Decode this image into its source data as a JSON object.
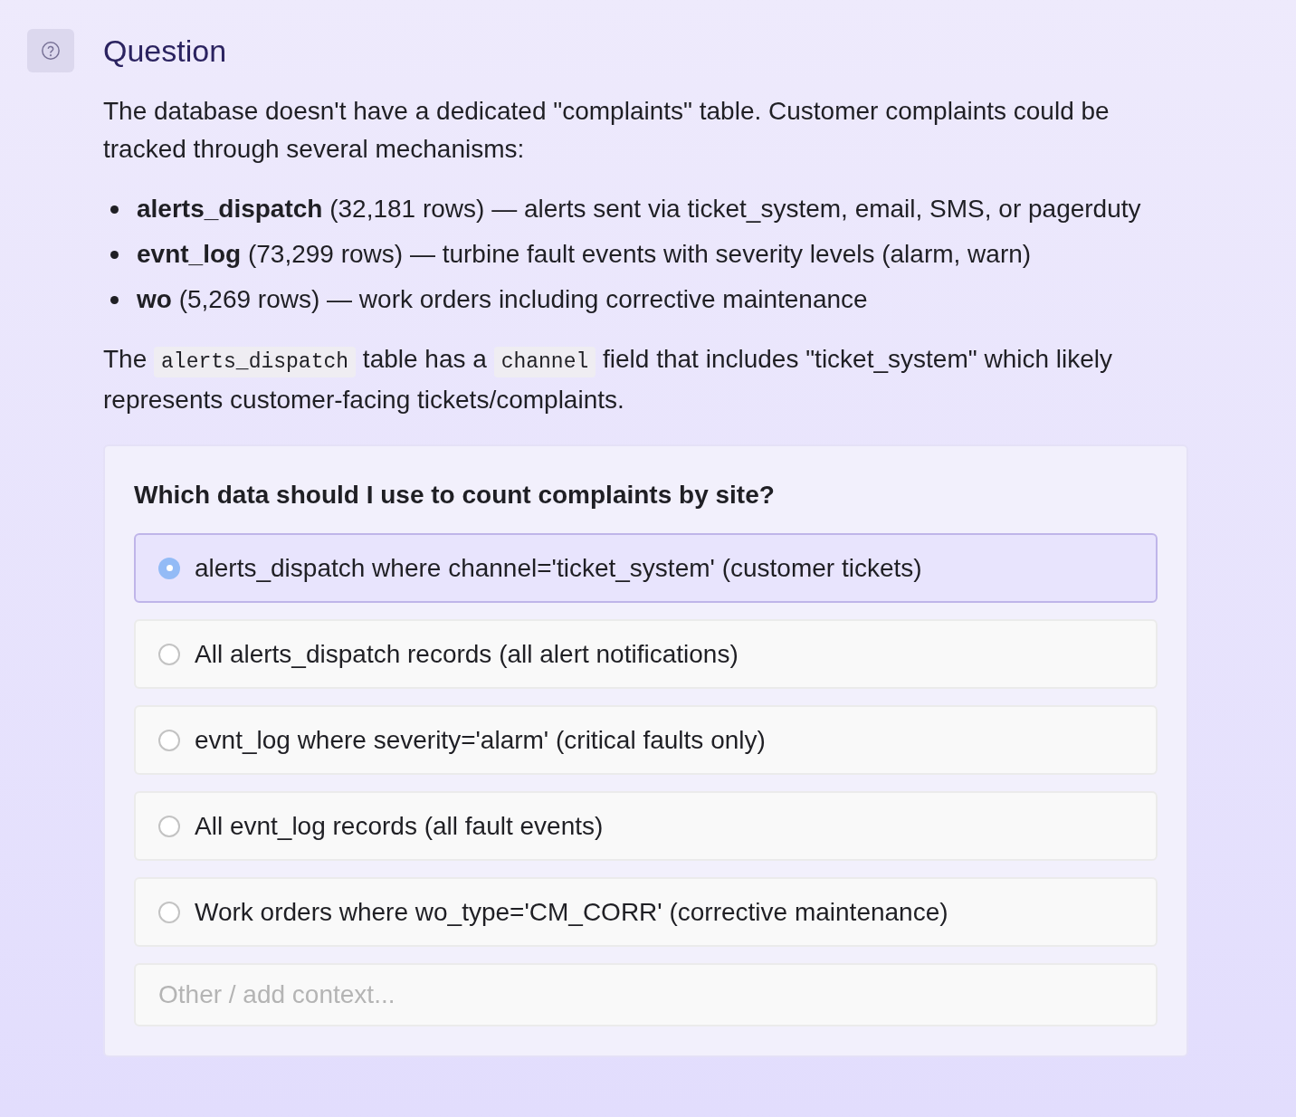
{
  "header": {
    "title": "Question"
  },
  "intro": "The database doesn't have a dedicated \"complaints\" table. Customer complaints could be tracked through several mechanisms:",
  "sources": [
    "**alerts_dispatch** (32,181 rows) — alerts sent via ticket_system, email, SMS, or pagerduty",
    "**evnt_log** (73,299 rows) — turbine fault events with severity levels (alarm, warn)",
    "**wo** (5,269 rows) — work orders including corrective maintenance"
  ],
  "note": [
    {
      "kind": "text",
      "text": "The"
    },
    {
      "kind": "code",
      "text": "alerts_dispatch"
    },
    {
      "kind": "text",
      "text": "table has a"
    },
    {
      "kind": "code",
      "text": "channel"
    },
    {
      "kind": "text",
      "text": "field that includes \"ticket_system\" which likely represents customer-facing tickets/complaints."
    }
  ],
  "question": {
    "prompt": "Which data should I use to count complaints by site?",
    "options": [
      {
        "label": "alerts_dispatch where channel='ticket_system' (customer tickets)",
        "selected": true
      },
      {
        "label": "All alerts_dispatch records (all alert notifications)",
        "selected": false
      },
      {
        "label": "evnt_log where severity='alarm' (critical faults only)",
        "selected": false
      },
      {
        "label": "All evnt_log records (all fault events)",
        "selected": false
      },
      {
        "label": "Work orders where wo_type='CM_CORR' (corrective maintenance)",
        "selected": false
      }
    ],
    "other": {
      "placeholder": "Other / add context..."
    }
  }
}
